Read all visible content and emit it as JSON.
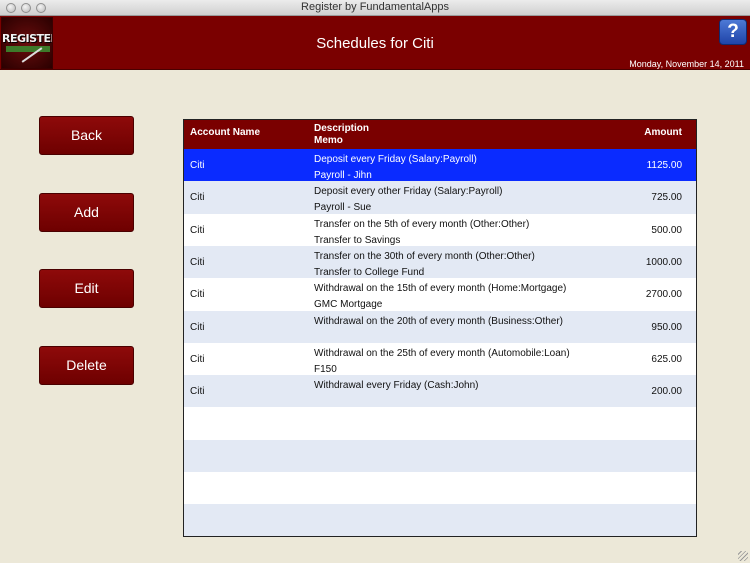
{
  "window": {
    "title": "Register by FundamentalApps"
  },
  "header": {
    "logo_text": "REGISTER",
    "title": "Schedules for Citi",
    "help_label": "?",
    "date": "Monday, November 14, 2011"
  },
  "actions": {
    "back": "Back",
    "add": "Add",
    "edit": "Edit",
    "delete": "Delete"
  },
  "table": {
    "headers": {
      "account": "Account Name",
      "description": "Description",
      "memo": "Memo",
      "amount": "Amount"
    },
    "rows": [
      {
        "account": "Citi",
        "description": "Deposit every Friday  (Salary:Payroll)",
        "memo": "Payroll - Jihn",
        "amount": "1125.00",
        "selected": true
      },
      {
        "account": "Citi",
        "description": "Deposit every other Friday  (Salary:Payroll)",
        "memo": "Payroll - Sue",
        "amount": "725.00"
      },
      {
        "account": "Citi",
        "description": "Transfer  on the 5th of every month  (Other:Other)",
        "memo": "Transfer to Savings",
        "amount": "500.00"
      },
      {
        "account": "Citi",
        "description": "Transfer  on the 30th of every month  (Other:Other)",
        "memo": "Transfer to College Fund",
        "amount": "1000.00"
      },
      {
        "account": "Citi",
        "description": "Withdrawal  on the 15th of every month  (Home:Mortgage)",
        "memo": "GMC Mortgage",
        "amount": "2700.00"
      },
      {
        "account": "Citi",
        "description": "Withdrawal  on the 20th of every month  (Business:Other)",
        "memo": "",
        "amount": "950.00"
      },
      {
        "account": "Citi",
        "description": "Withdrawal  on the 25th of every month  (Automobile:Loan)",
        "memo": "F150",
        "amount": "625.00"
      },
      {
        "account": "Citi",
        "description": "Withdrawal every Friday  (Cash:John)",
        "memo": "",
        "amount": "200.00"
      }
    ]
  },
  "colors": {
    "header_bg": "#7a0000",
    "selection": "#0a2bff",
    "row_alt": "#e3e9f4",
    "page_bg": "#ece8d8"
  }
}
